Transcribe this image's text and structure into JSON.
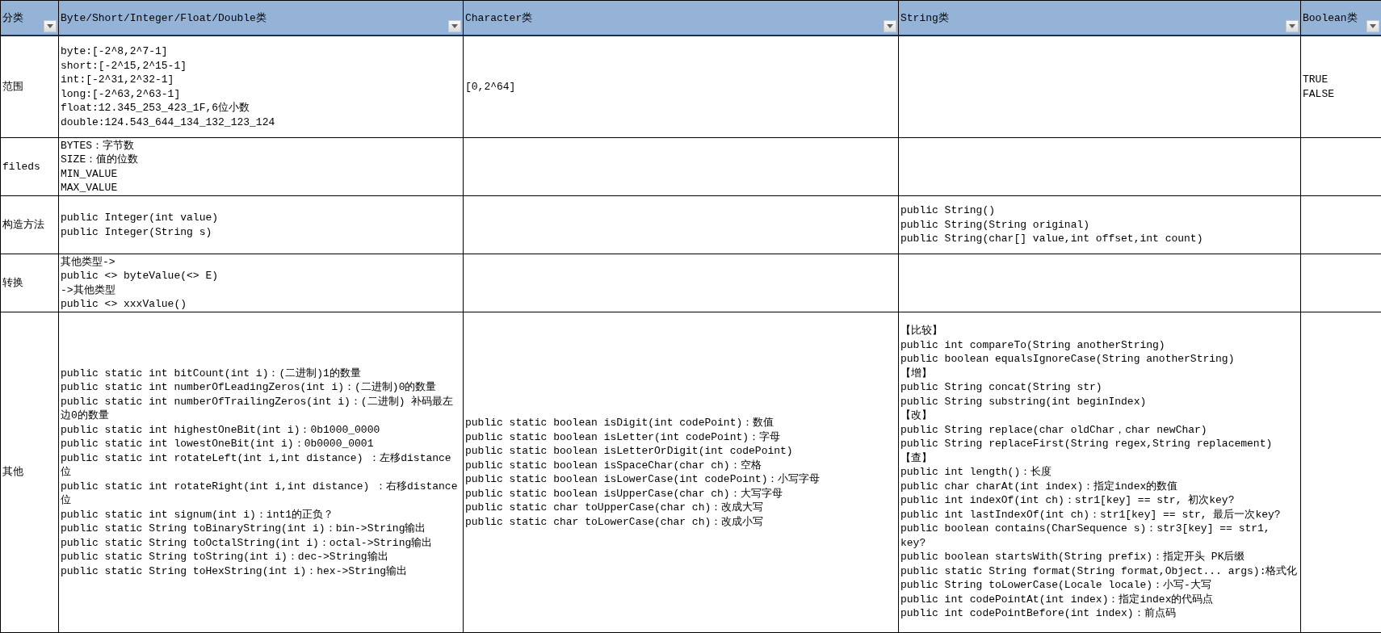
{
  "table": {
    "columns": [
      {
        "label": "分类"
      },
      {
        "label": "Byte/Short/Integer/Float/Double类"
      },
      {
        "label": "Character类"
      },
      {
        "label": "String类"
      },
      {
        "label": "Boolean类"
      }
    ],
    "rows": [
      {
        "cells": [
          "范围",
          "byte:[-2^8,2^7-1]\nshort:[-2^15,2^15-1]\nint:[-2^31,2^32-1]\nlong:[-2^63,2^63-1]\nfloat:12.345_253_423_1F,6位小数\ndouble:124.543_644_134_132_123_124",
          "[0,2^64]",
          "",
          "TRUE\nFALSE"
        ]
      },
      {
        "cells": [
          "fileds",
          "BYTES：字节数\nSIZE：值的位数\nMIN_VALUE\nMAX_VALUE",
          "",
          "",
          ""
        ]
      },
      {
        "cells": [
          "构造方法",
          "public Integer(int value)\npublic Integer(String s)",
          "",
          "public String()\npublic String(String original)\npublic String(char[] value,int offset,int count)",
          ""
        ]
      },
      {
        "cells": [
          "转换",
          "其他类型->\npublic <> byteValue(<> E)\n->其他类型\npublic <> xxxValue()",
          "",
          "",
          ""
        ]
      },
      {
        "cells": [
          "其他",
          "public static int bitCount(int i)：(二进制)1的数量\npublic static int numberOfLeadingZeros(int i)：(二进制)0的数量\npublic static int numberOfTrailingZeros(int i)：(二进制) 补码最左边0的数量\npublic static int highestOneBit(int i)：0b1000_0000\npublic static int lowestOneBit(int i)：0b0000_0001\npublic static int rotateLeft(int i,int distance) ：左移distance位\npublic static int rotateRight(int i,int distance) ：右移distance位\npublic static int signum(int i)：int1的正负？\npublic static String toBinaryString(int i)：bin->String输出\npublic static String toOctalString(int i)：octal->String输出\npublic static String toString(int i)：dec->String输出\npublic static String toHexString(int i)：hex->String输出",
          "public static boolean isDigit(int codePoint)：数值\npublic static boolean isLetter(int codePoint)：字母\npublic static boolean isLetterOrDigit(int codePoint)\npublic static boolean isSpaceChar(char ch)：空格\npublic static boolean isLowerCase(int codePoint)：小写字母\npublic static boolean isUpperCase(char ch)：大写字母\npublic static char toUpperCase(char ch)：改成大写\npublic static char toLowerCase(char ch)：改成小写",
          "【比较】\npublic int compareTo(String anotherString)\npublic boolean equalsIgnoreCase(String anotherString)\n【增】\npublic String concat(String str)\npublic String substring(int beginIndex)\n【改】\npublic String replace(char oldChar，char newChar)\npublic String replaceFirst(String regex,String replacement)\n【查】\npublic int length()：长度\npublic char charAt(int index)：指定index的数值\npublic int indexOf(int ch)：str1[key] == str, 初次key?\npublic int lastIndexOf(int ch)：str1[key] == str, 最后一次key?\npublic boolean contains(CharSequence s)：str3[key] == str1, key?\npublic boolean startsWith(String prefix)：指定开头 PK后缀\npublic static String format(String format,Object... args):格式化\npublic String toLowerCase(Locale locale)：小写-大写\npublic int codePointAt(int index)：指定index的代码点\npublic int codePointBefore(int index)：前点码",
          ""
        ]
      }
    ]
  }
}
